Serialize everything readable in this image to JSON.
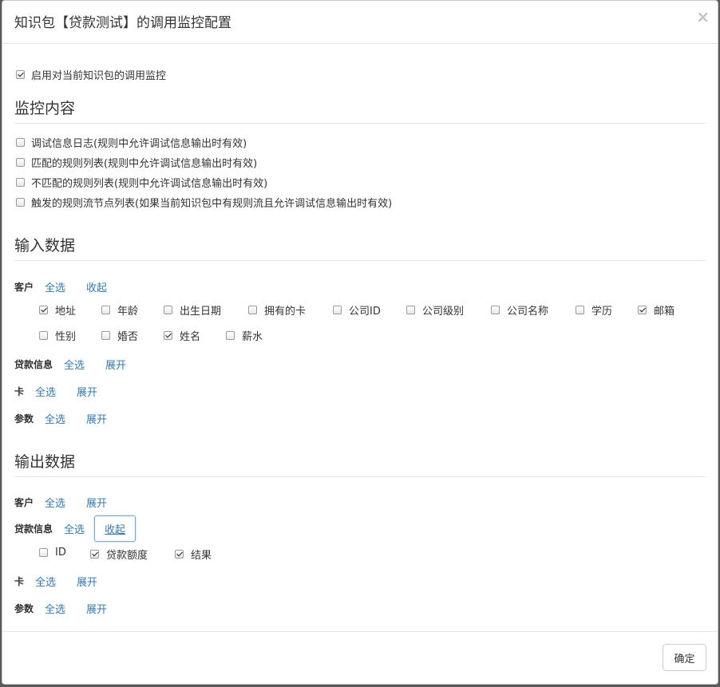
{
  "dialog": {
    "title": "知识包【贷款测试】的调用监控配置",
    "close_symbol": "×",
    "ok_label": "确定"
  },
  "enable_monitor": {
    "label": "启用对当前知识包的调用监控",
    "checked": true
  },
  "monitor_content": {
    "title": "监控内容",
    "options": [
      {
        "label": "调试信息日志(规则中允许调试信息输出时有效)",
        "checked": false
      },
      {
        "label": "匹配的规则列表(规则中允许调试信息输出时有效)",
        "checked": false
      },
      {
        "label": "不匹配的规则列表(规则中允许调试信息输出时有效)",
        "checked": false
      },
      {
        "label": "触发的规则流节点列表(如果当前知识包中有规则流且允许调试信息输出时有效)",
        "checked": false
      }
    ]
  },
  "input_data": {
    "title": "输入数据",
    "groups": [
      {
        "name": "客户",
        "select_all": "全选",
        "toggle": "收起",
        "fields": [
          {
            "label": "地址",
            "checked": true
          },
          {
            "label": "年龄",
            "checked": false
          },
          {
            "label": "出生日期",
            "checked": false
          },
          {
            "label": "拥有的卡",
            "checked": false
          },
          {
            "label": "公司ID",
            "checked": false
          },
          {
            "label": "公司级别",
            "checked": false
          },
          {
            "label": "公司名称",
            "checked": false
          },
          {
            "label": "学历",
            "checked": false
          },
          {
            "label": "邮箱",
            "checked": true
          },
          {
            "label": "性别",
            "checked": false
          },
          {
            "label": "婚否",
            "checked": false
          },
          {
            "label": "姓名",
            "checked": true
          },
          {
            "label": "薪水",
            "checked": false
          }
        ]
      },
      {
        "name": "贷款信息",
        "select_all": "全选",
        "toggle": "展开"
      },
      {
        "name": "卡",
        "select_all": "全选",
        "toggle": "展开"
      },
      {
        "name": "参数",
        "select_all": "全选",
        "toggle": "展开"
      }
    ]
  },
  "output_data": {
    "title": "输出数据",
    "groups": [
      {
        "name": "客户",
        "select_all": "全选",
        "toggle": "展开"
      },
      {
        "name": "贷款信息",
        "select_all": "全选",
        "toggle": "收起",
        "fields": [
          {
            "label": "ID",
            "checked": false
          },
          {
            "label": "贷款额度",
            "checked": true
          },
          {
            "label": "结果",
            "checked": true
          }
        ]
      },
      {
        "name": "卡",
        "select_all": "全选",
        "toggle": "展开"
      },
      {
        "name": "参数",
        "select_all": "全选",
        "toggle": "展开"
      }
    ]
  }
}
